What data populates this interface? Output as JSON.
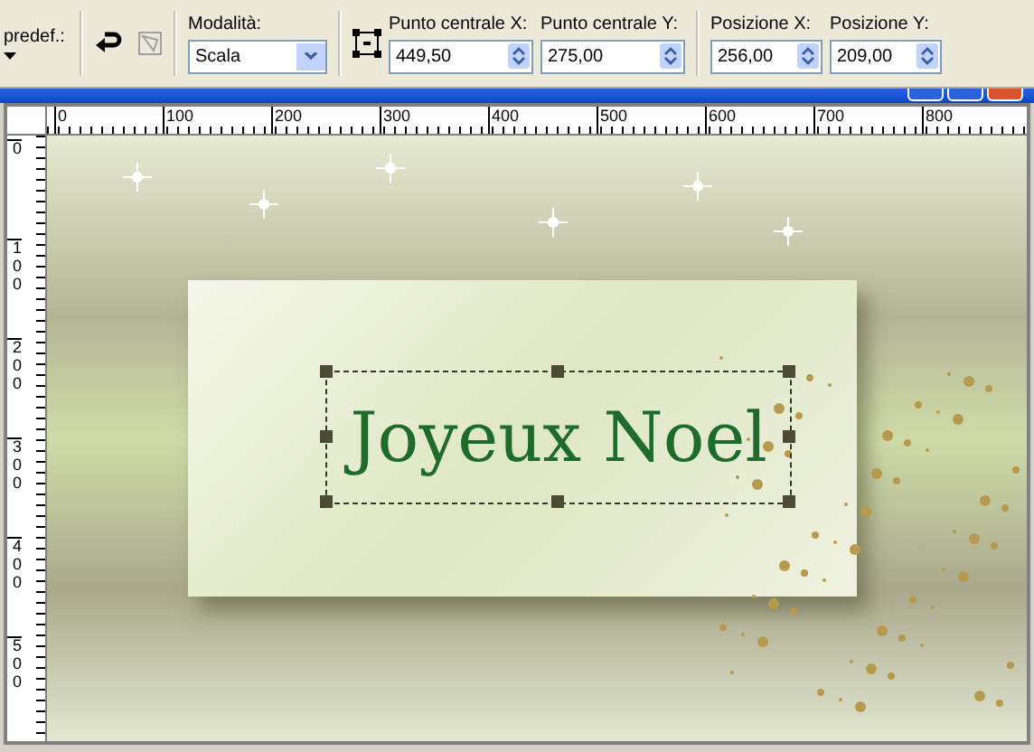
{
  "toolbar": {
    "preset_label": "predef.:",
    "mode": {
      "label": "Modalità:",
      "value": "Scala"
    },
    "fields": [
      {
        "label": "Punto centrale X:",
        "value": "449,50"
      },
      {
        "label": "Punto centrale Y:",
        "value": "275,00"
      },
      {
        "label": "Posizione X:",
        "value": "256,00"
      },
      {
        "label": "Posizione Y:",
        "value": "209,00"
      }
    ]
  },
  "rulers": {
    "horizontal": [
      "0",
      "100",
      "200",
      "300",
      "400",
      "500",
      "600",
      "700",
      "800"
    ],
    "vertical": [
      "0",
      "100",
      "200",
      "300",
      "400",
      "500"
    ]
  },
  "canvas": {
    "text": "Joyeux Noel"
  }
}
